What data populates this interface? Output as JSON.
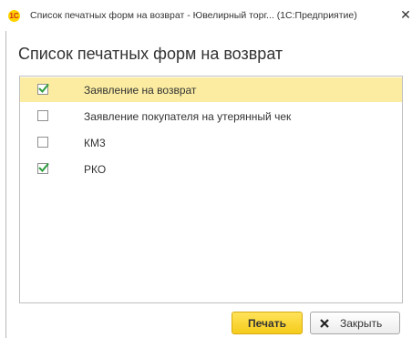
{
  "window": {
    "title": "Список печатных форм на возврат - Ювелирный торг... (1С:Предприятие)",
    "app_icon_text": "1С",
    "close_glyph": "✕"
  },
  "heading": "Список печатных форм на возврат",
  "items": [
    {
      "label": "Заявление на возврат",
      "checked": true,
      "selected": true
    },
    {
      "label": "Заявление покупателя на утерянный чек",
      "checked": false,
      "selected": false
    },
    {
      "label": "КМ3",
      "checked": false,
      "selected": false
    },
    {
      "label": "РКО",
      "checked": true,
      "selected": false
    }
  ],
  "buttons": {
    "print_label": "Печать",
    "close_label": "Закрыть"
  },
  "colors": {
    "selected_row": "#fbeca1",
    "checkmark": "#2e9e3f",
    "print_button": "#f5cc1b"
  },
  "icons": {
    "app": "1c-logo-icon",
    "close": "close-icon",
    "check": "checkmark-icon"
  }
}
